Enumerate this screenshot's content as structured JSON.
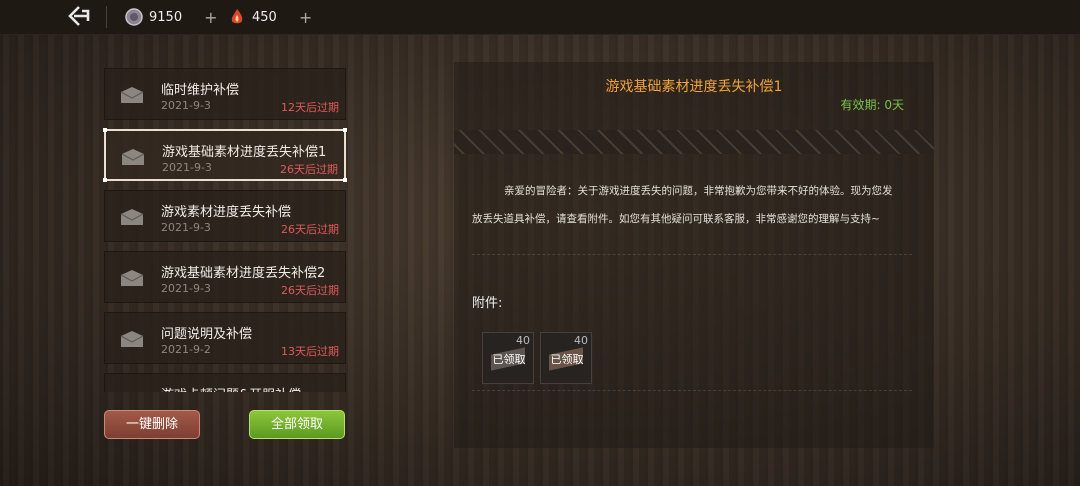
{
  "topbar": {
    "back_icon": "return-arrow-icon",
    "currencies": [
      {
        "icon": "stone-coin-icon",
        "value": "9150",
        "plus": "+"
      },
      {
        "icon": "flame-gem-icon",
        "value": "450",
        "plus": "+"
      }
    ]
  },
  "mails": [
    {
      "title": "临时维护补偿",
      "date": "2021-9-3",
      "expiry": "12天后过期",
      "selected": false
    },
    {
      "title": "游戏基础素材进度丢失补偿1",
      "date": "2021-9-3",
      "expiry": "26天后过期",
      "selected": true
    },
    {
      "title": "游戏素材进度丢失补偿",
      "date": "2021-9-3",
      "expiry": "26天后过期",
      "selected": false
    },
    {
      "title": "游戏基础素材进度丢失补偿2",
      "date": "2021-9-3",
      "expiry": "26天后过期",
      "selected": false
    },
    {
      "title": "问题说明及补偿",
      "date": "2021-9-2",
      "expiry": "13天后过期",
      "selected": false
    },
    {
      "title": "游戏卡顿问题&开服补偿",
      "date": "",
      "expiry": "",
      "selected": false
    }
  ],
  "buttons": {
    "delete_all": "一键删除",
    "claim_all": "全部领取"
  },
  "detail": {
    "title": "游戏基础素材进度丢失补偿1",
    "validity": "有效期: 0天",
    "line1": "亲爱的冒险者：关于游戏进度丢失的问题，非常抱歉为您带来不好的体验。现为您发",
    "line2": "放丢失道具补偿，请查看附件。如您有其他疑问可联系客服，非常感谢您的理解与支持~",
    "attachments_label": "附件:",
    "attachments": [
      {
        "count": "40",
        "status": "已领取",
        "icon": "material-bar-icon"
      },
      {
        "count": "40",
        "status": "已领取",
        "icon": "material-bar-icon"
      }
    ]
  },
  "colors": {
    "title": "#f2a33a",
    "validity": "#7bc24a",
    "expiry": "#e05a5a",
    "claim": "#8cc63a",
    "delete": "#a35a48"
  }
}
